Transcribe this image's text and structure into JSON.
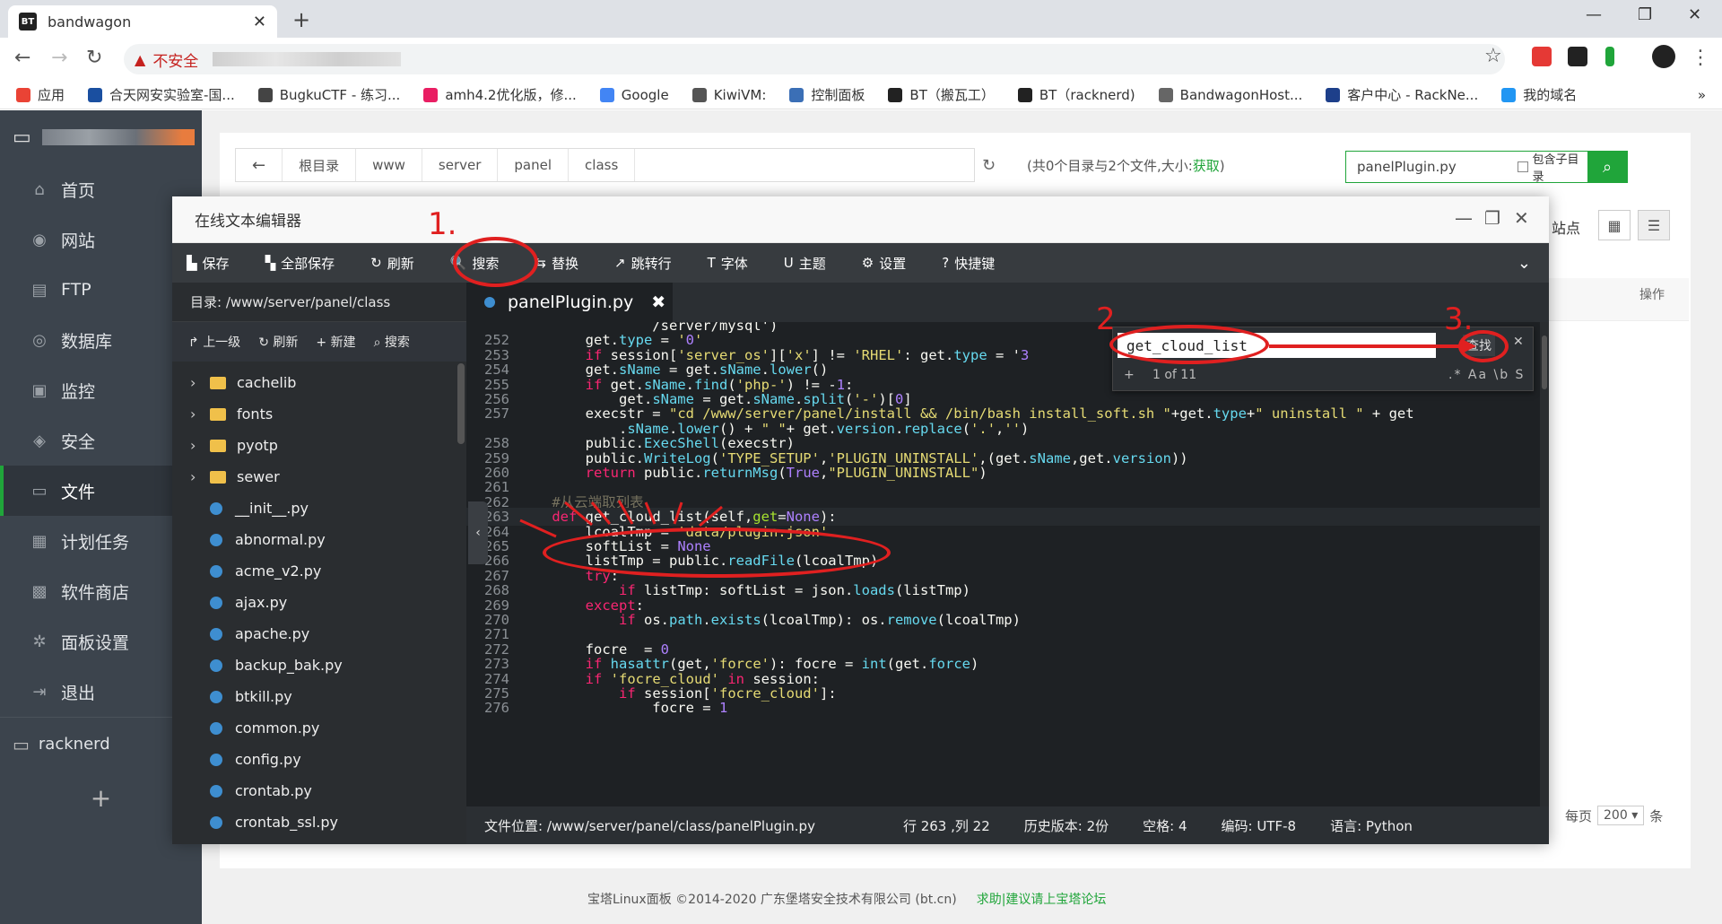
{
  "browser": {
    "tab_title": "bandwagon",
    "tab_icon": "BT",
    "new_tab": "+",
    "address_warning": "不安全",
    "controls": {
      "minimize": "—",
      "maximize": "❐",
      "close": "✕"
    },
    "bookmarks": [
      {
        "label": "应用",
        "color": "#ea4335"
      },
      {
        "label": "合天网安实验室-国...",
        "color": "#1a4fa0"
      },
      {
        "label": "BugkuCTF - 练习...",
        "color": "#444444"
      },
      {
        "label": "amh4.2优化版，修...",
        "color": "#e91e63"
      },
      {
        "label": "Google",
        "color": "#4285f4"
      },
      {
        "label": "KiwiVM:",
        "color": "#555555"
      },
      {
        "label": "控制面板",
        "color": "#3b6fb6"
      },
      {
        "label": "BT（搬瓦工）",
        "color": "#222222"
      },
      {
        "label": "BT（racknerd)",
        "color": "#222222"
      },
      {
        "label": "BandwagonHost...",
        "color": "#666666"
      },
      {
        "label": "客户中心 - RackNe...",
        "color": "#1d3f8a"
      },
      {
        "label": "我的域名",
        "color": "#2196f3"
      }
    ],
    "bookmarks_more": "»"
  },
  "sidebar": {
    "items": [
      {
        "label": "首页",
        "icon": "⌂"
      },
      {
        "label": "网站",
        "icon": "◉"
      },
      {
        "label": "FTP",
        "icon": "▤"
      },
      {
        "label": "数据库",
        "icon": "◎"
      },
      {
        "label": "监控",
        "icon": "▣"
      },
      {
        "label": "安全",
        "icon": "◈"
      },
      {
        "label": "文件",
        "icon": "▭"
      },
      {
        "label": "计划任务",
        "icon": "▦"
      },
      {
        "label": "软件商店",
        "icon": "▩"
      },
      {
        "label": "面板设置",
        "icon": "✲"
      },
      {
        "label": "退出",
        "icon": "⇥"
      }
    ],
    "server_name": "racknerd",
    "add": "+"
  },
  "files": {
    "breadcrumb": [
      "根目录",
      "www",
      "server",
      "panel",
      "class"
    ],
    "info_prefix": "(共0个目录与2个文件,大小:",
    "info_link": "获取",
    "info_suffix": ")",
    "search_value": "panelPlugin.py",
    "include_sub": "包含子目录",
    "right_partial": "站点",
    "op_header": "操作",
    "per_page_label": "每页",
    "per_page_value": "200",
    "per_page_unit": "条"
  },
  "editor": {
    "title": "在线文本编辑器",
    "toolbar": [
      {
        "label": "保存",
        "icon": "▙"
      },
      {
        "label": "全部保存",
        "icon": "▚"
      },
      {
        "label": "刷新",
        "icon": "↻"
      },
      {
        "label": "搜索",
        "icon": "🔍"
      },
      {
        "label": "替换",
        "icon": "⇆"
      },
      {
        "label": "跳转行",
        "icon": "↗"
      },
      {
        "label": "字体",
        "icon": "T"
      },
      {
        "label": "主题",
        "icon": "U"
      },
      {
        "label": "设置",
        "icon": "⚙"
      },
      {
        "label": "快捷键",
        "icon": "?"
      }
    ],
    "tree_path_label": "目录:",
    "tree_path": "/www/server/panel/class",
    "tree_tools": [
      "上一级",
      "刷新",
      "新建",
      "搜索"
    ],
    "folders": [
      "cachelib",
      "fonts",
      "pyotp",
      "sewer"
    ],
    "files": [
      "__init__.py",
      "abnormal.py",
      "acme_v2.py",
      "ajax.py",
      "apache.py",
      "backup_bak.py",
      "btkill.py",
      "common.py",
      "config.py",
      "crontab.py",
      "crontab_ssl.py"
    ],
    "open_tab": "panelPlugin.py",
    "search": {
      "value": "get_cloud_list",
      "find_button": "查找",
      "count": "1 of 11",
      "options": ".* Aa \\b S"
    },
    "status": {
      "path_label": "文件位置:",
      "path": "/www/server/panel/class/panelPlugin.py",
      "cursor": "行 263 ,列 22",
      "history": "历史版本: 2份",
      "indent": "空格: 4",
      "encoding": "编码: UTF-8",
      "language": "语言: Python"
    },
    "code_lines": [
      {
        "n": "",
        "t": "                /server/mysql')",
        "partial": true
      },
      {
        "n": "252",
        "t": "        get.type = '0'"
      },
      {
        "n": "253",
        "t": "        if session['server_os']['x'] != 'RHEL': get.type = '3"
      },
      {
        "n": "254",
        "t": "        get.sName = get.sName.lower()"
      },
      {
        "n": "255",
        "t": "        if get.sName.find('php-') != -1:"
      },
      {
        "n": "256",
        "t": "            get.sName = get.sName.split('-')[0]"
      },
      {
        "n": "257",
        "t": "        execstr = \"cd /www/server/panel/install && /bin/bash install_soft.sh \"+get.type+\" uninstall \" + get"
      },
      {
        "n": "",
        "t": "            .sName.lower() + \" \"+ get.version.replace('.','')"
      },
      {
        "n": "258",
        "t": "        public.ExecShell(execstr)"
      },
      {
        "n": "259",
        "t": "        public.WriteLog('TYPE_SETUP','PLUGIN_UNINSTALL',(get.sName,get.version))"
      },
      {
        "n": "260",
        "t": "        return public.returnMsg(True,\"PLUGIN_UNINSTALL\")"
      },
      {
        "n": "261",
        "t": ""
      },
      {
        "n": "262",
        "t": "    #从云端取列表"
      },
      {
        "n": "263",
        "t": "    def get_cloud_list(self,get=None):"
      },
      {
        "n": "264",
        "t": "        lcoalTmp = 'data/plugin.json'"
      },
      {
        "n": "265",
        "t": "        softList = None"
      },
      {
        "n": "266",
        "t": "        listTmp = public.readFile(lcoalTmp)"
      },
      {
        "n": "267",
        "t": "        try:"
      },
      {
        "n": "268",
        "t": "            if listTmp: softList = json.loads(listTmp)"
      },
      {
        "n": "269",
        "t": "        except:"
      },
      {
        "n": "270",
        "t": "            if os.path.exists(lcoalTmp): os.remove(lcoalTmp)"
      },
      {
        "n": "271",
        "t": ""
      },
      {
        "n": "272",
        "t": "        focre  = 0"
      },
      {
        "n": "273",
        "t": "        if hasattr(get,'force'): focre = int(get.force)"
      },
      {
        "n": "274",
        "t": "        if 'focre_cloud' in session:"
      },
      {
        "n": "275",
        "t": "            if session['focre_cloud']:"
      },
      {
        "n": "276",
        "t": "                focre = 1"
      }
    ]
  },
  "annotations": {
    "step1": "1.",
    "step2": "2",
    "step3": "3."
  },
  "footer": {
    "copyright": "宝塔Linux面板 ©2014-2020 广东堡塔安全技术有限公司 (bt.cn)",
    "link": "求助|建议请上宝塔论坛"
  },
  "colors": {
    "accent": "#20a53a",
    "annotation": "#e02020"
  }
}
